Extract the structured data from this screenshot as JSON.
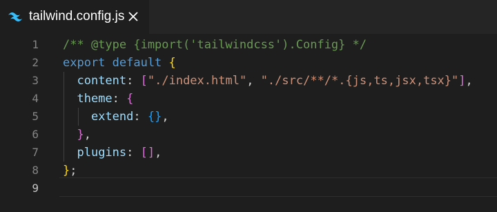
{
  "tab": {
    "filename": "tailwind.config.js",
    "icon": "tailwind-icon",
    "close_icon": "close-icon",
    "icon_color": "#38bdf8"
  },
  "gutter": {
    "line_numbers": [
      "1",
      "2",
      "3",
      "4",
      "5",
      "6",
      "7",
      "8",
      "9"
    ]
  },
  "code": {
    "l1": {
      "comment": "/** @type {import('tailwindcss').Config} */"
    },
    "l2": {
      "kw": "export default",
      "brace": "{"
    },
    "l3": {
      "prop": "content",
      "colon": ":",
      "open": "[",
      "s1": "\"./index.html\"",
      "comma1": ",",
      "s2": "\"./src/**/*.{js,ts,jsx,tsx}\"",
      "close": "]",
      "comma2": ","
    },
    "l4": {
      "prop": "theme",
      "colon": ":",
      "brace": "{"
    },
    "l5": {
      "prop": "extend",
      "colon": ":",
      "obj": "{}",
      "comma": ","
    },
    "l6": {
      "brace": "}",
      "comma": ","
    },
    "l7": {
      "prop": "plugins",
      "colon": ":",
      "arr": "[]",
      "comma": ","
    },
    "l8": {
      "brace": "}",
      "semi": ";"
    },
    "l9": {
      "text": ""
    }
  }
}
